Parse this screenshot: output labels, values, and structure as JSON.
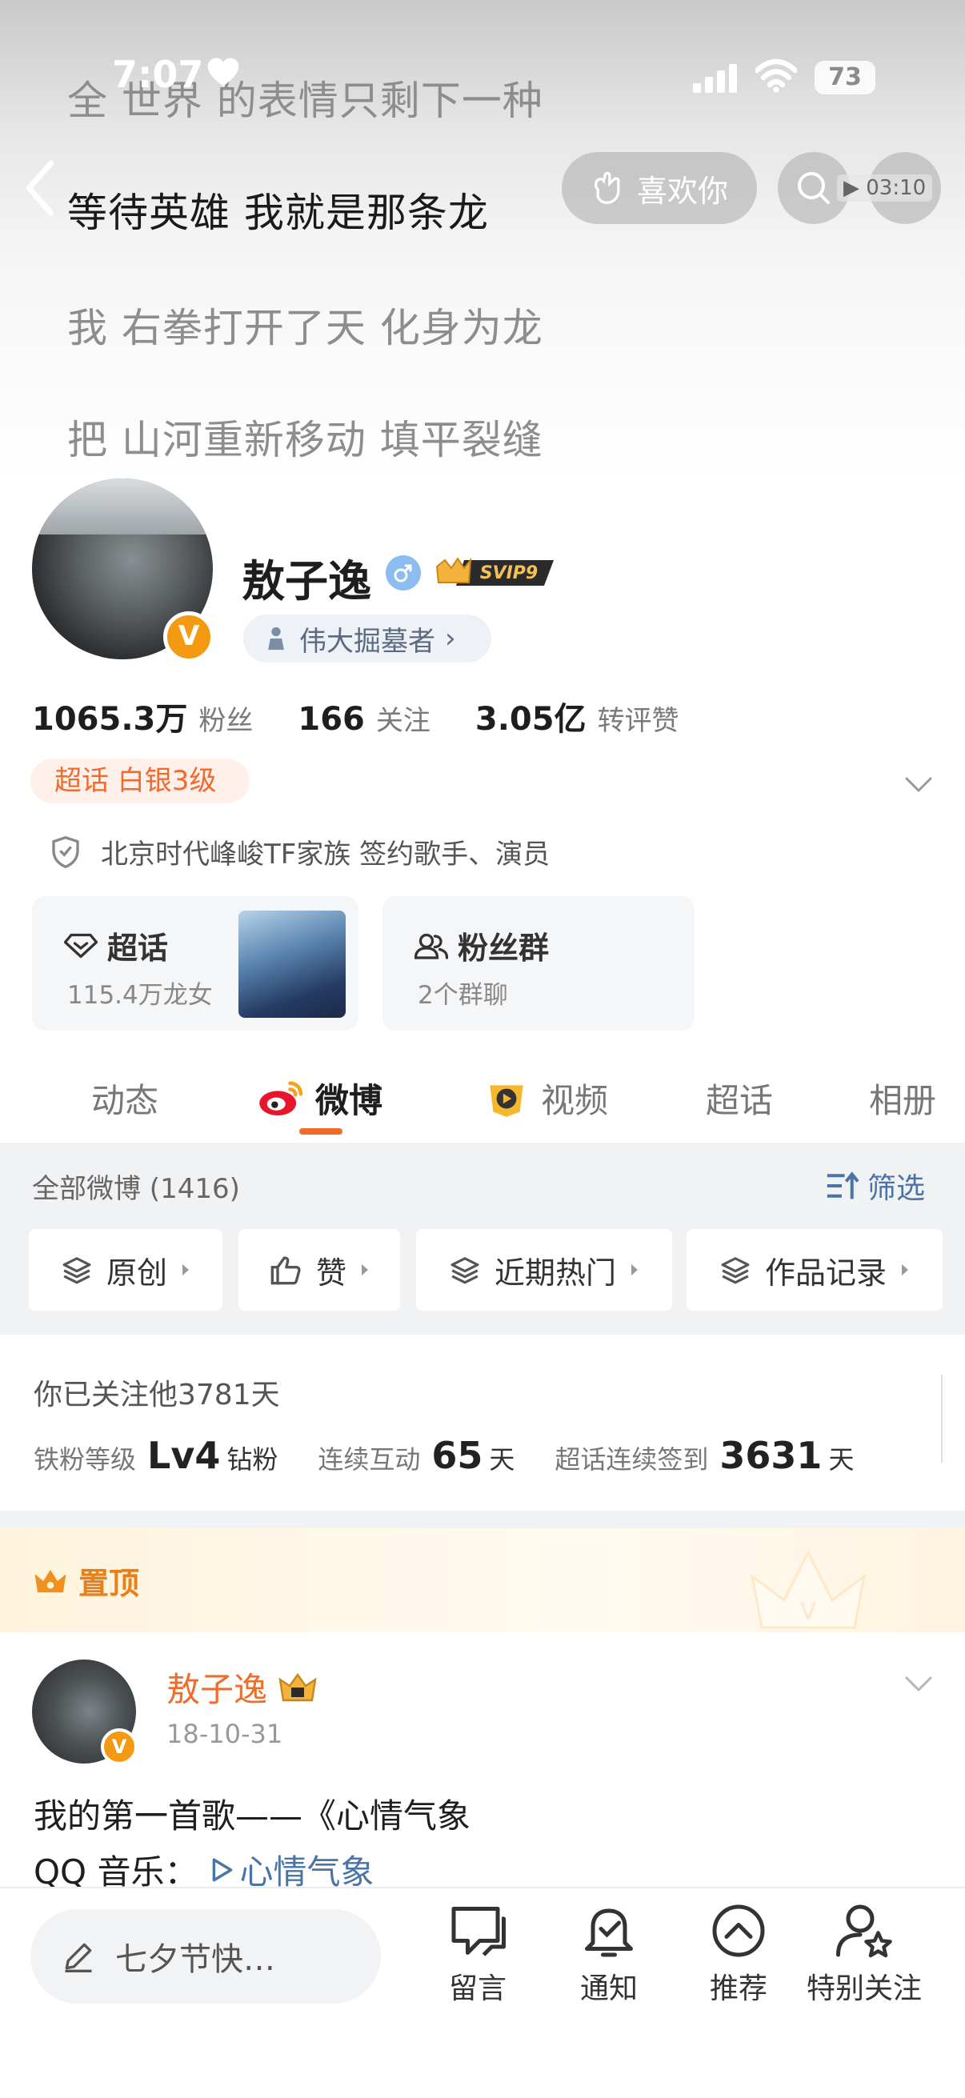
{
  "status_bar": {
    "time": "7:07",
    "battery": "73"
  },
  "lyrics": [
    "全 世界 的表情只剩下一种",
    "等待英雄 我就是那条龙",
    "我 右拳打开了天 化身为龙",
    "把 山河重新移动 填平裂缝"
  ],
  "nav": {
    "like_label": "喜欢你",
    "music_time": "03:10"
  },
  "profile": {
    "name": "敖子逸",
    "verify_mark": "V",
    "vip_label": "SVIP9",
    "title": "伟大掘墓者",
    "followers": "1065.3万",
    "followers_label": "粉丝",
    "following": "166",
    "following_label": "关注",
    "likes": "3.05亿",
    "likes_label": "转评赞",
    "chaohua_level": "超话 白银3级",
    "agency": "北京时代峰峻TF家族 签约歌手、演员"
  },
  "cards": [
    {
      "title": "超话",
      "sub": "115.4万龙女"
    },
    {
      "title": "粉丝群",
      "sub": "2个群聊"
    }
  ],
  "tabs": [
    "动态",
    "微博",
    "视频",
    "超话",
    "相册"
  ],
  "filter": {
    "header": "全部微博 (1416)",
    "filter_label": "筛选",
    "chips": [
      "原创",
      "赞",
      "近期热门",
      "作品记录"
    ]
  },
  "fan": {
    "title": "你已关注他3781天",
    "level_label": "铁粉等级",
    "level_value": "Lv4",
    "level_suffix": "钻粉",
    "interact_label": "连续互动",
    "interact_value": "65",
    "interact_unit": "天",
    "signin_label": "超话连续签到",
    "signin_value": "3631",
    "signin_unit": "天"
  },
  "pinned": {
    "label": "置顶",
    "author": "敖子逸",
    "date": "18-10-31",
    "text": "我的第一首歌——《心情气象",
    "music_prefix": "QQ 音乐：",
    "music_link": "心情气象"
  },
  "bottom_bar": {
    "input_placeholder": "七夕节快…",
    "buttons": [
      "留言",
      "通知",
      "推荐",
      "特别关注"
    ]
  },
  "colors": {
    "accent": "#f26b2a",
    "link": "#4a74a8",
    "vip_gold": "#f3b23c"
  }
}
